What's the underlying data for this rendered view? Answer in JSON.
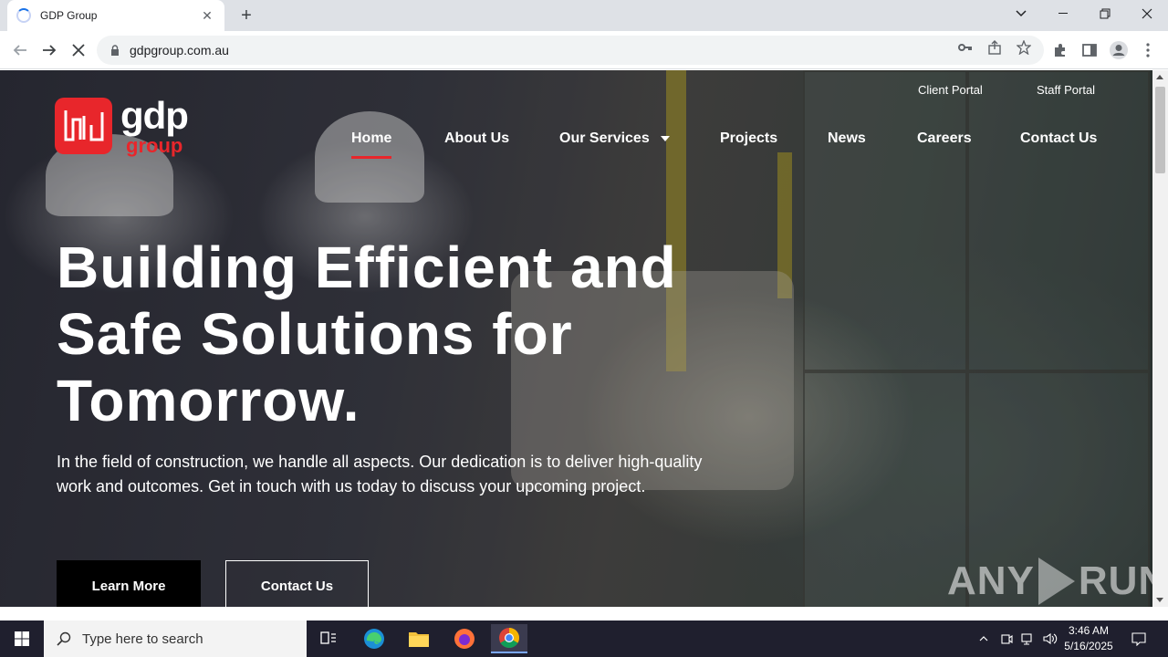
{
  "browser": {
    "tab_title": "GDP Group",
    "url": "gdpgroup.com.au"
  },
  "site": {
    "logo_primary": "gdp",
    "logo_secondary": "group",
    "utility_links": [
      "Client Portal",
      "Staff Portal"
    ],
    "nav": [
      "Home",
      "About Us",
      "Our Services",
      "Projects",
      "News",
      "Careers",
      "Contact Us"
    ],
    "active_nav": "Home",
    "headline": "Building Efficient and Safe Solutions for Tomorrow.",
    "lede": "In the field of construction, we handle all aspects. Our dedication is to deliver high-quality work and outcomes. Get in touch with us today to discuss your upcoming project.",
    "cta_primary": "Learn More",
    "cta_secondary": "Contact Us",
    "brand_red": "#e8262b"
  },
  "watermark": {
    "left": "ANY",
    "right": "RUN"
  },
  "taskbar": {
    "search_placeholder": "Type here to search",
    "time": "3:46 AM",
    "date": "5/16/2025"
  }
}
